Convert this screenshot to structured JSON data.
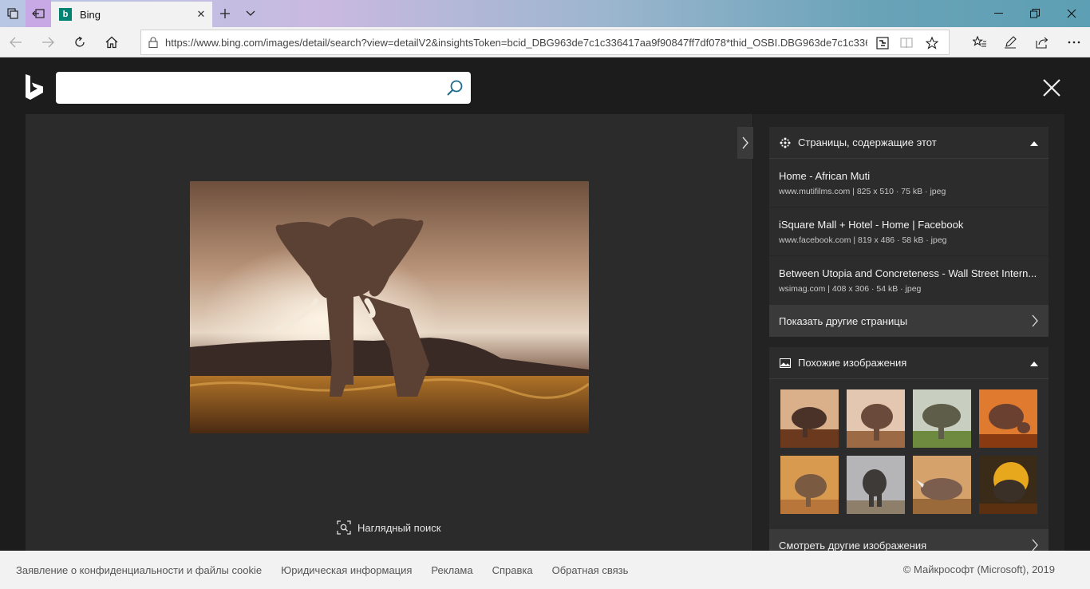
{
  "browser": {
    "tab_title": "Bing",
    "tab_favicon_letter": "b",
    "address_url": "https://www.bing.com/images/detail/search?view=detailV2&insightsToken=bcid_DBG963de7c1c336417aa9f90847ff7df078*thid_OSBI.DBG963de7c1c336"
  },
  "search": {
    "value": "",
    "placeholder": ""
  },
  "viewer": {
    "visual_search_label": "Наглядный поиск"
  },
  "pages_card": {
    "title": "Страницы, содержащие этот",
    "items": [
      {
        "title": "Home - African Muti",
        "meta": "www.mutifilms.com | 825 x 510 · 75 kB · jpeg"
      },
      {
        "title": "iSquare Mall + Hotel - Home | Facebook",
        "meta": "www.facebook.com | 819 x 486 · 58 kB · jpeg"
      },
      {
        "title": "Between Utopia and Concreteness - Wall Street Intern...",
        "meta": "wsimag.com | 408 x 306 · 54 kB · jpeg"
      }
    ],
    "more_label": "Показать другие страницы"
  },
  "similar_card": {
    "title": "Похожие изображения",
    "more_label": "Смотреть другие изображения"
  },
  "footer": {
    "links": [
      "Заявление о конфиденциальности и файлы cookie",
      "Юридическая информация",
      "Реклама",
      "Справка",
      "Обратная связь"
    ],
    "copyright": "© Майкрософт (Microsoft), 2019"
  },
  "colors": {
    "accent": "#008373",
    "page_bg": "#1c1c1c",
    "card_bg": "#2c2c2c"
  }
}
